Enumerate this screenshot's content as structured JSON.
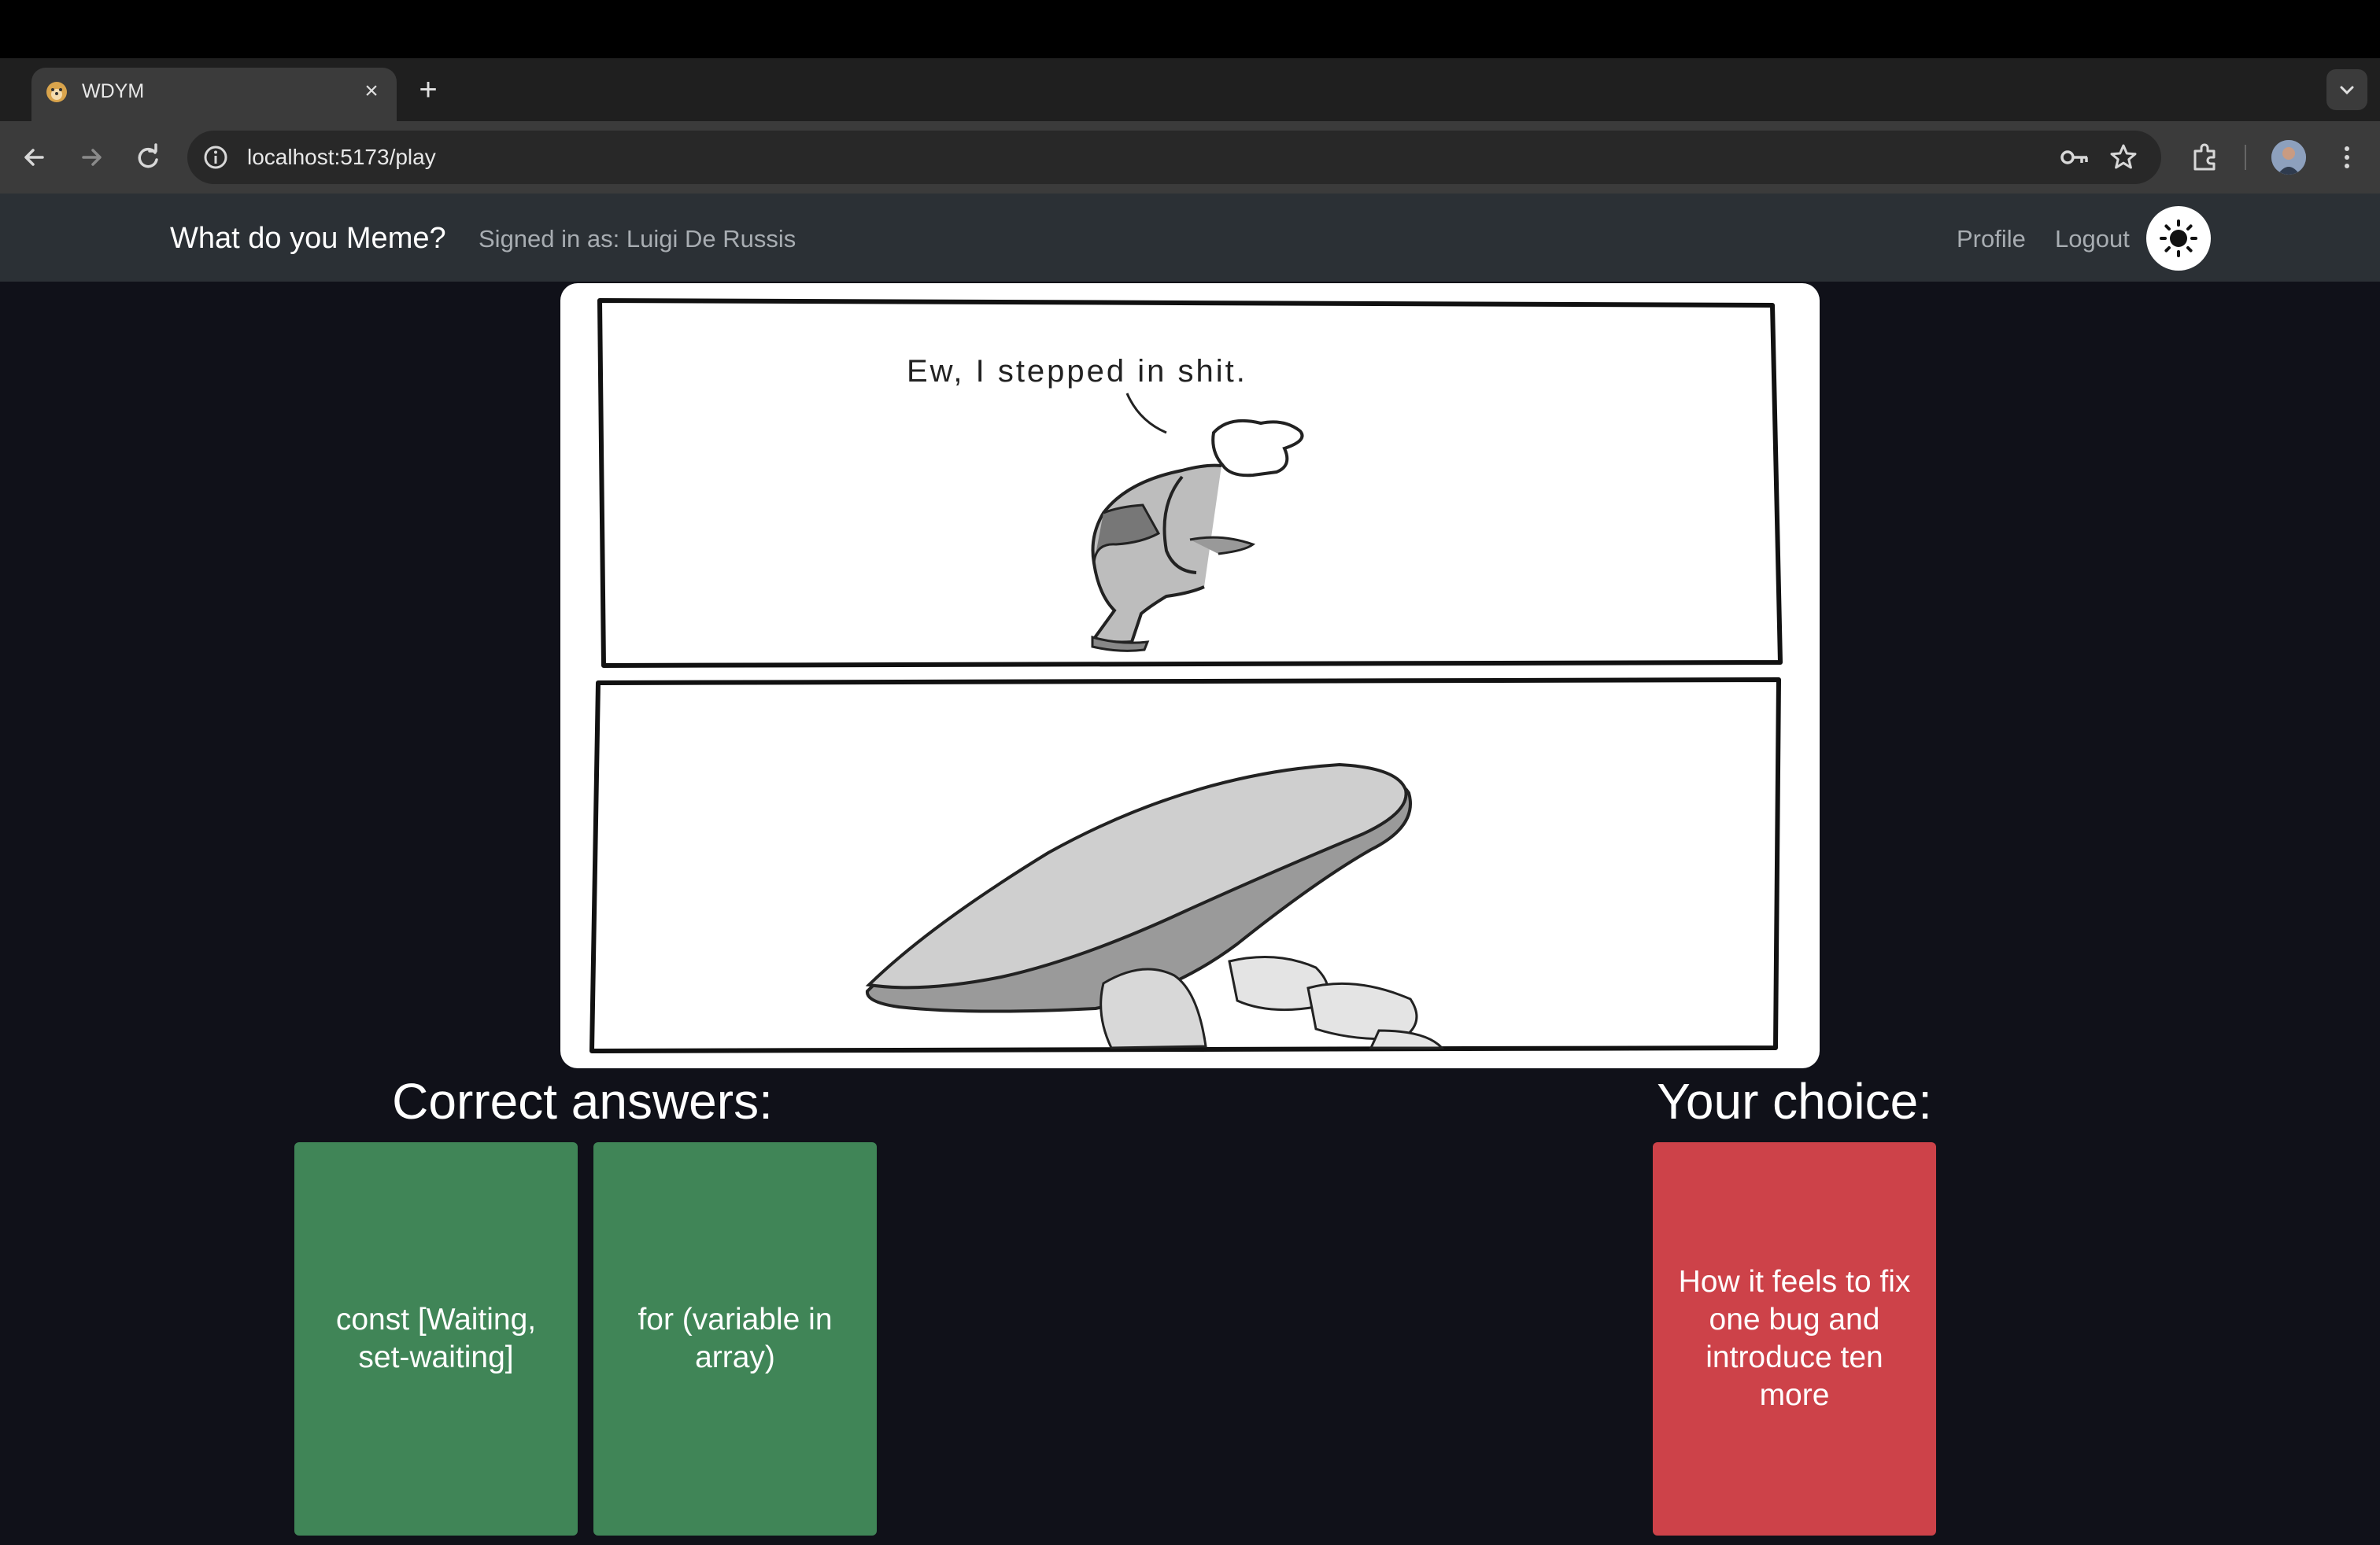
{
  "browser": {
    "tab_title": "WDYM",
    "url": "localhost:5173/play"
  },
  "navbar": {
    "brand": "What do you Meme?",
    "signed_in": "Signed in as: Luigi De Russis",
    "profile_label": "Profile",
    "logout_label": "Logout"
  },
  "meme": {
    "caption": "Ew, I stepped in shit."
  },
  "results": {
    "correct_heading": "Correct answers:",
    "choice_heading": "Your choice:",
    "correct_answers": [
      "const [Waiting, set-waiting]",
      "for (variable in array)"
    ],
    "your_choice": "How it feels to fix one bug and introduce ten more"
  },
  "colors": {
    "correct_card": "#408557",
    "wrong_card": "#cd4249",
    "page_background": "#101119",
    "navbar_background": "#2b3035"
  },
  "icons": [
    "dog-favicon-icon",
    "close-icon",
    "plus-icon",
    "chevron-down-icon",
    "back-arrow-icon",
    "forward-arrow-icon",
    "reload-icon",
    "info-icon",
    "key-icon",
    "star-icon",
    "extensions-icon",
    "profile-avatar",
    "kebab-menu-icon",
    "sun-icon"
  ]
}
